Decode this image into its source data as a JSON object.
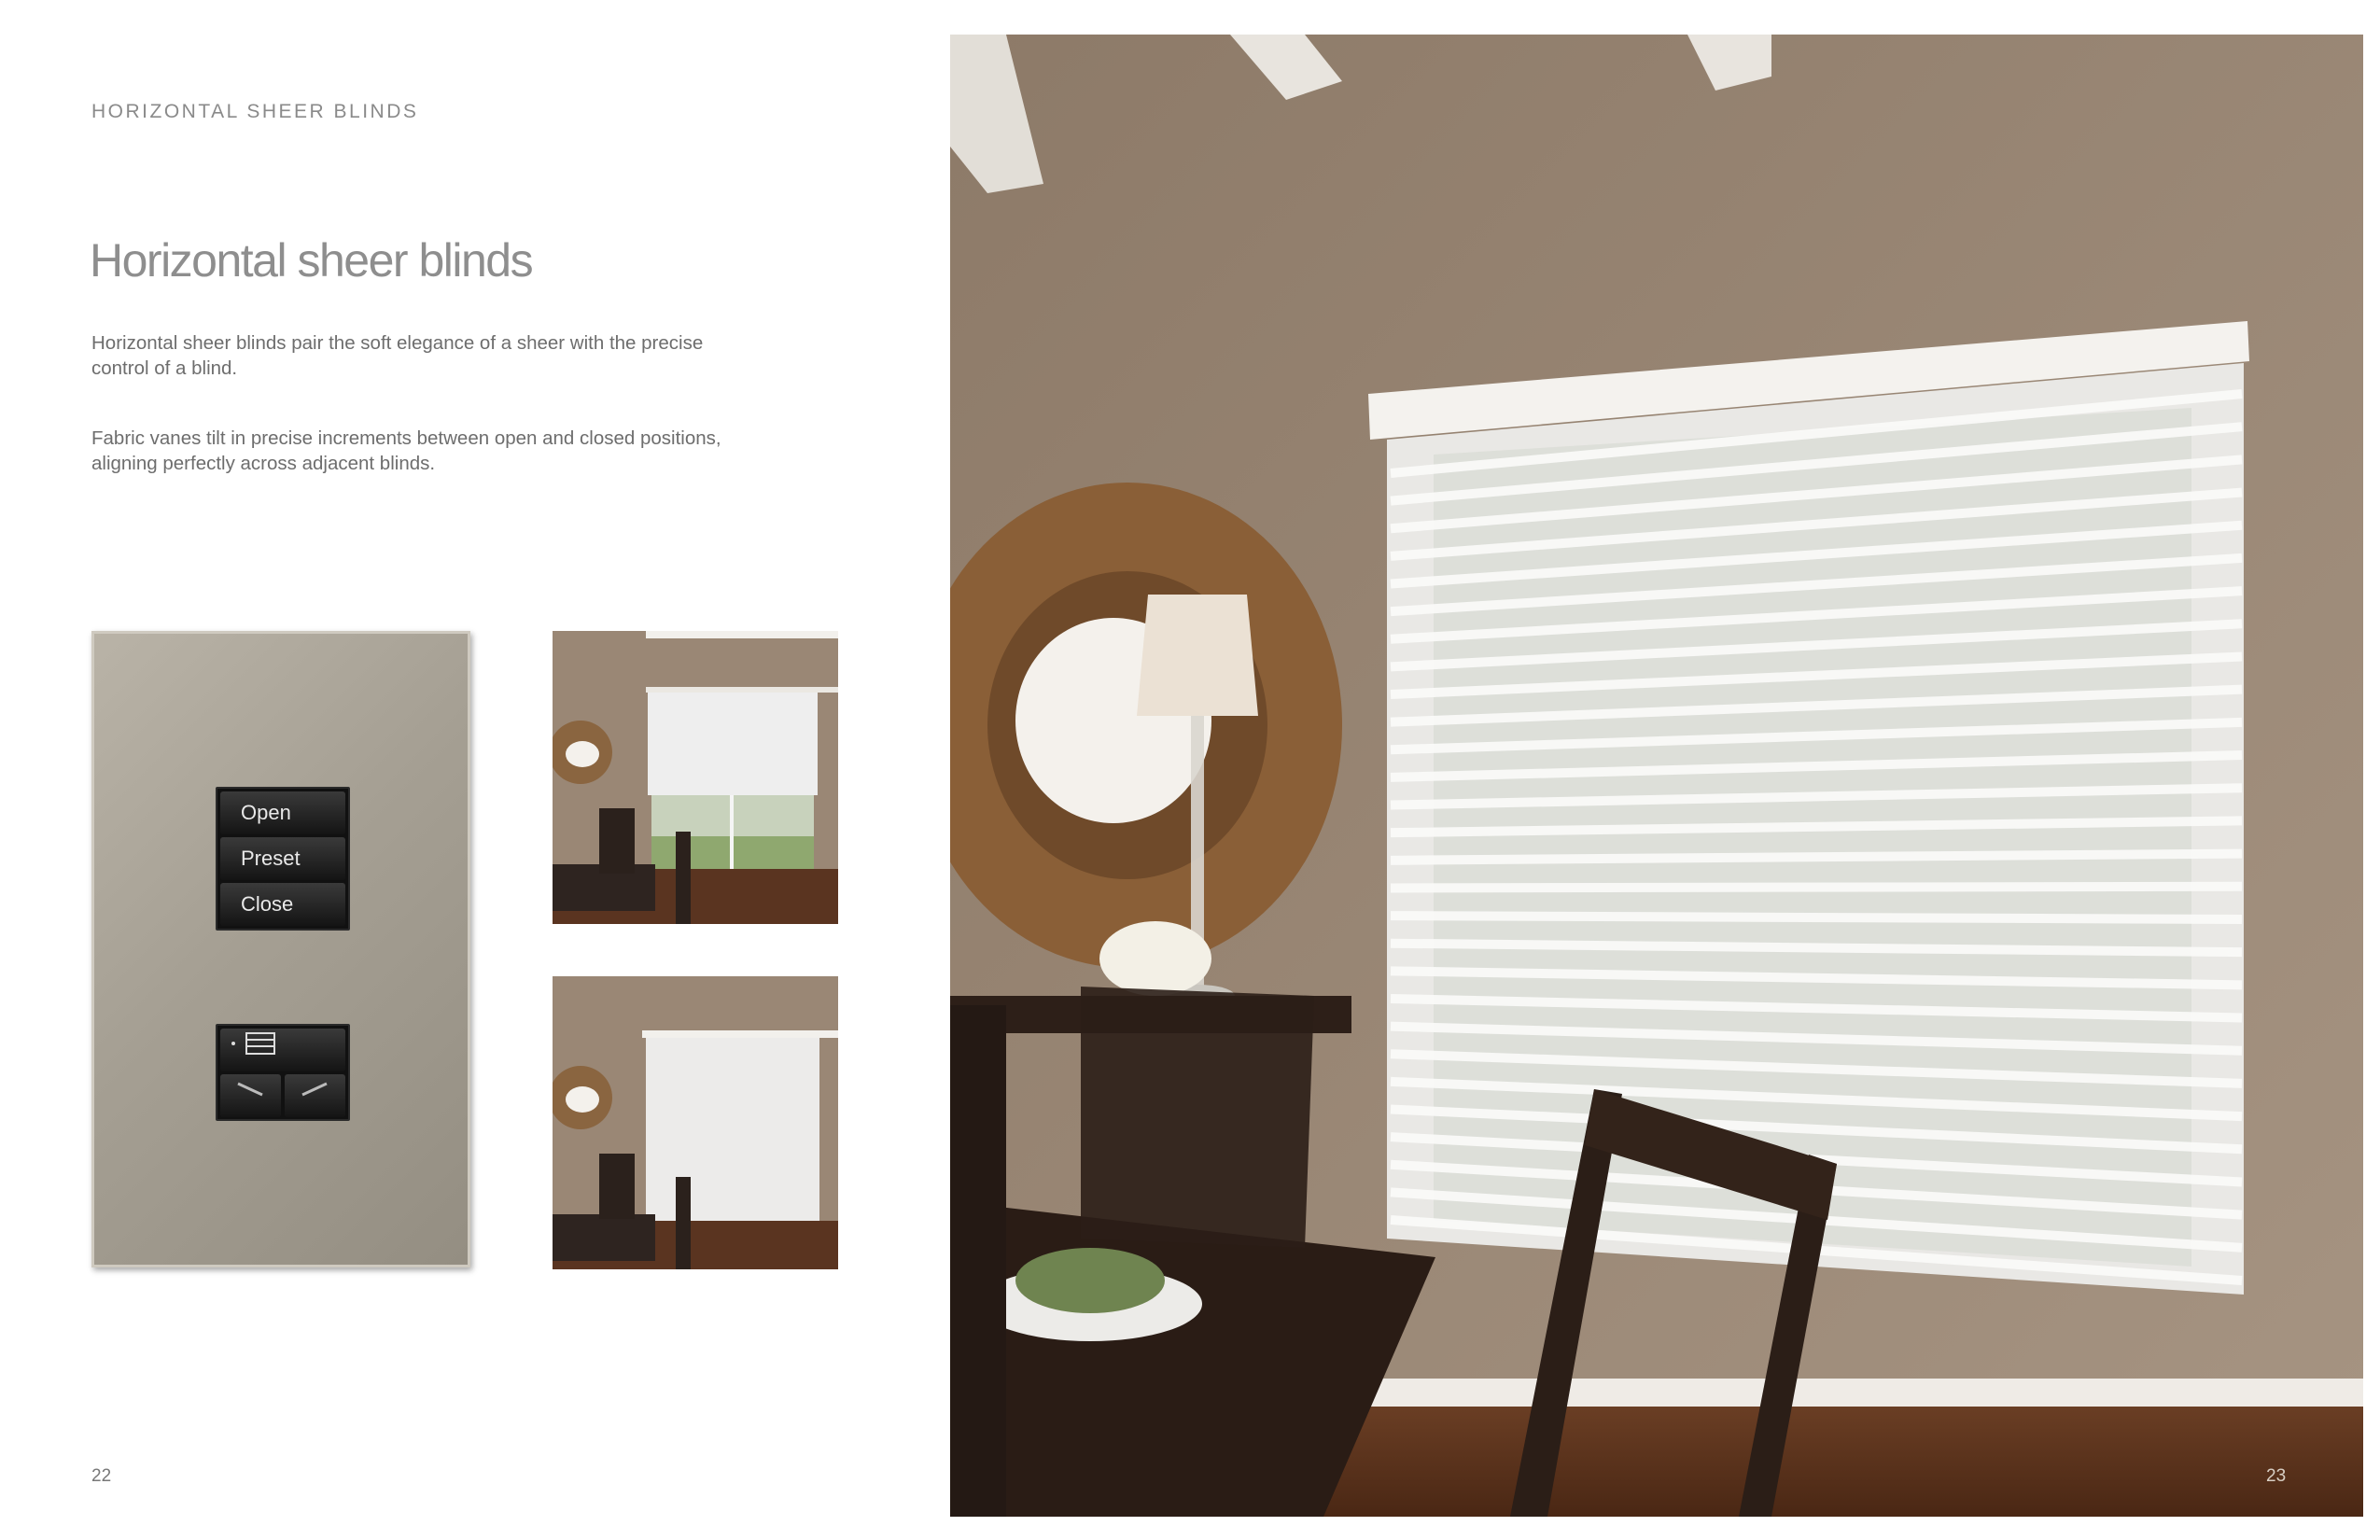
{
  "header": {
    "section_label": "HORIZONTAL SHEER BLINDS"
  },
  "title": "Horizontal sheer blinds",
  "paragraphs": [
    "Horizontal sheer blinds pair the soft elegance of a sheer with the precise control of a blind.",
    "Fabric vanes tilt in precise increments between open and closed positions, aligning perfectly across adjacent blinds."
  ],
  "keypad": {
    "buttons": [
      "Open",
      "Preset",
      "Close"
    ],
    "lower_icons": [
      "menu-icon",
      "lower-arrow-icon",
      "raise-arrow-icon"
    ]
  },
  "images": {
    "thumb_1": "dining-room-shade-raised",
    "thumb_2": "dining-room-shade-lowered",
    "hero": "dining-room-horizontal-sheer-blinds"
  },
  "colors": {
    "wall": "#9c8a77",
    "text": "#6d6d6d",
    "heading": "#8e8e8e"
  },
  "pages": {
    "left": "22",
    "right": "23"
  }
}
